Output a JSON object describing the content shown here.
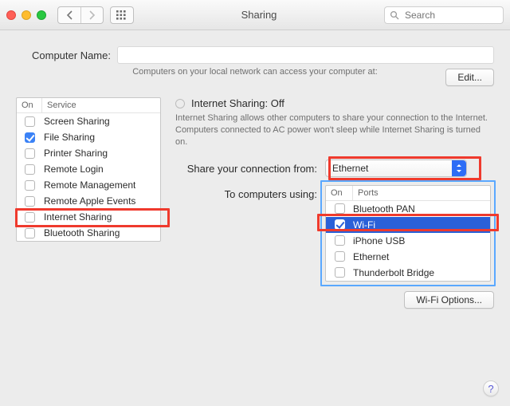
{
  "window": {
    "title": "Sharing",
    "search_placeholder": "Search"
  },
  "computer_name": {
    "label": "Computer Name:",
    "value": "",
    "hint": "Computers on your local network can access your computer at:",
    "edit_button": "Edit..."
  },
  "services": {
    "header_on": "On",
    "header_service": "Service",
    "items": [
      {
        "label": "Screen Sharing",
        "on": false
      },
      {
        "label": "File Sharing",
        "on": true
      },
      {
        "label": "Printer Sharing",
        "on": false
      },
      {
        "label": "Remote Login",
        "on": false
      },
      {
        "label": "Remote Management",
        "on": false
      },
      {
        "label": "Remote Apple Events",
        "on": false
      },
      {
        "label": "Internet Sharing",
        "on": false
      },
      {
        "label": "Bluetooth Sharing",
        "on": false
      }
    ]
  },
  "detail": {
    "heading": "Internet Sharing: Off",
    "description": "Internet Sharing allows other computers to share your connection to the Internet. Computers connected to AC power won't sleep while Internet Sharing is turned on.",
    "share_from_label": "Share your connection from:",
    "share_from_value": "Ethernet",
    "to_label": "To computers using:",
    "ports_header_on": "On",
    "ports_header_ports": "Ports",
    "ports": [
      {
        "label": "Bluetooth PAN",
        "on": false,
        "selected": false
      },
      {
        "label": "Wi-Fi",
        "on": true,
        "selected": true
      },
      {
        "label": "iPhone USB",
        "on": false,
        "selected": false
      },
      {
        "label": "Ethernet",
        "on": false,
        "selected": false
      },
      {
        "label": "Thunderbolt Bridge",
        "on": false,
        "selected": false
      }
    ],
    "wifi_options_button": "Wi-Fi Options..."
  },
  "help_button": "?"
}
